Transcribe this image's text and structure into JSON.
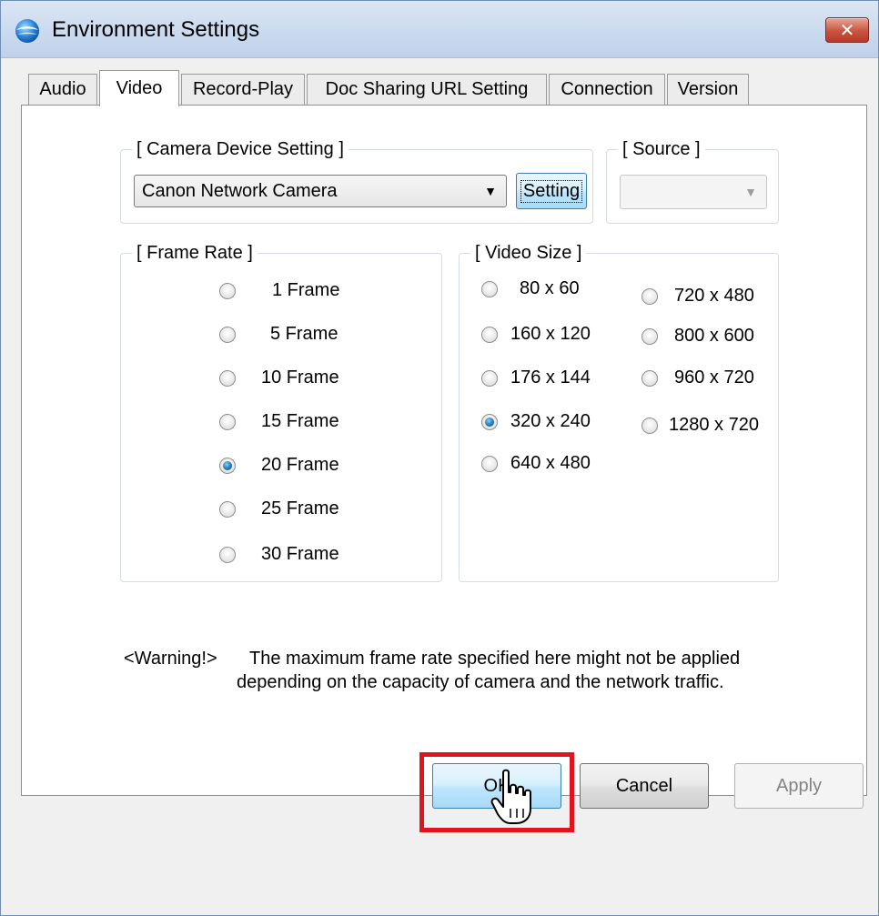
{
  "window": {
    "title": "Environment Settings",
    "close_glyph": "✕"
  },
  "tabs": [
    {
      "label": "Audio",
      "active": false
    },
    {
      "label": "Video",
      "active": true
    },
    {
      "label": "Record-Play",
      "active": false
    },
    {
      "label": "Doc Sharing URL Setting",
      "active": false
    },
    {
      "label": "Connection",
      "active": false
    },
    {
      "label": "Version",
      "active": false
    }
  ],
  "camera_device": {
    "group_label": "[ Camera Device Setting ]",
    "selected_value": "Canon Network Camera",
    "setting_button": "Setting"
  },
  "source": {
    "group_label": "[ Source ]",
    "selected_value": ""
  },
  "frame_rate": {
    "group_label": "[ Frame Rate ]",
    "options": [
      "1 Frame",
      "5 Frame",
      "10 Frame",
      "15 Frame",
      "20 Frame",
      "25 Frame",
      "30 Frame"
    ],
    "selected": "20 Frame"
  },
  "video_size": {
    "group_label": "[ Video Size ]",
    "options": [
      "80 x 60",
      "160 x 120",
      "176 x 144",
      "320 x 240",
      "640 x 480",
      "720 x 480",
      "800 x 600",
      "960 x 720",
      "1280 x 720"
    ],
    "selected": "320 x 240"
  },
  "warning": {
    "prefix": "<Warning!>",
    "line1": "The maximum frame rate specified here might not be applied",
    "line2": "depending on the capacity of camera and the network traffic."
  },
  "buttons": {
    "ok": "OK",
    "cancel": "Cancel",
    "apply": "Apply"
  },
  "colors": {
    "highlight": "#e0141e",
    "close_button": "#c95440",
    "radio_selected": "#1a6fb0"
  }
}
